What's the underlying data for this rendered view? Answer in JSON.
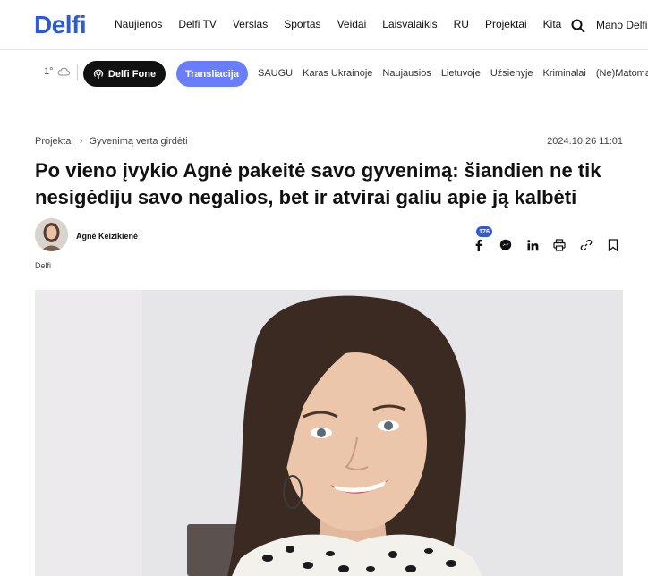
{
  "header": {
    "logo": "Delfi",
    "nav": [
      "Naujienos",
      "Delfi TV",
      "Verslas",
      "Sportas",
      "Veidai",
      "Laisvalaikis",
      "RU",
      "Projektai",
      "Kita"
    ],
    "account_label": "Mano Delfi"
  },
  "subbar": {
    "weather": "1°",
    "fone_label": "Delfi Fone",
    "live_label": "Transliacija",
    "links": [
      "SAUGU",
      "Karas Ukrainoje",
      "Naujausios",
      "Lietuvoje",
      "Užsienyje",
      "Kriminalai",
      "(Ne)Matoma"
    ]
  },
  "article": {
    "breadcrumb": [
      "Projektai",
      "Gyvenimą verta girdėti"
    ],
    "date": "2024.10.26 11:01",
    "title": "Po vieno įvykio Agnė pakeitė savo gyvenimą: šiandien ne tik nesigėdiju savo negalios, bet ir atvirai galiu apie ją kalbėti",
    "author": "Agnė Keizikienė",
    "source": "Delfi",
    "share_count": "176"
  },
  "icons": [
    "search-icon",
    "cloud-icon",
    "radio-icon",
    "facebook-icon",
    "messenger-icon",
    "linkedin-icon",
    "print-icon",
    "link-icon",
    "bookmark-icon"
  ],
  "colors": {
    "brand": "#2d5bd7",
    "live": "#6a7dff"
  }
}
